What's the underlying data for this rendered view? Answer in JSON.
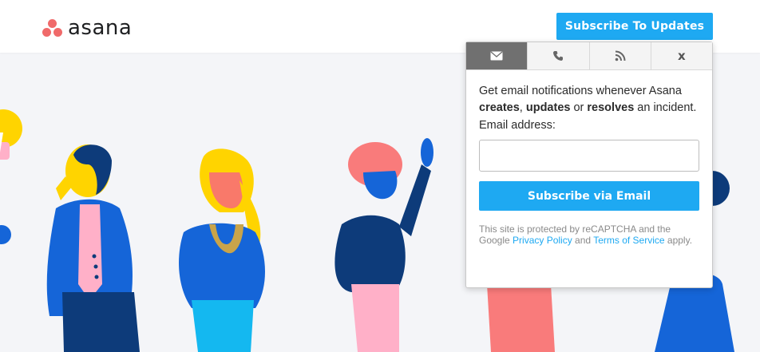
{
  "header": {
    "logo_text": "asana",
    "subscribe_button": "Subscribe To Updates"
  },
  "popup": {
    "tabs": [
      {
        "icon": "envelope-icon",
        "active": true
      },
      {
        "icon": "phone-icon",
        "active": false
      },
      {
        "icon": "rss-icon",
        "active": false
      },
      {
        "label": "x",
        "icon": "close-icon",
        "active": false
      }
    ],
    "description": {
      "part1": "Get email notifications whenever Asana ",
      "creates": "creates",
      "comma": ", ",
      "updates": "updates",
      "or": " or ",
      "resolves": "resolves",
      "part2": " an incident."
    },
    "email_label": "Email address:",
    "email_value": "",
    "email_placeholder": "",
    "submit_label": "Subscribe via Email",
    "recaptcha": {
      "text1": "This site is protected by reCAPTCHA and the Google ",
      "privacy_link": "Privacy Policy",
      "and": " and ",
      "terms_link": "Terms of Service",
      "text2": " apply."
    }
  },
  "colors": {
    "accent": "#1ea9f2",
    "logo_dots": "#f06a6a",
    "page_bg": "#f4f5f8"
  }
}
